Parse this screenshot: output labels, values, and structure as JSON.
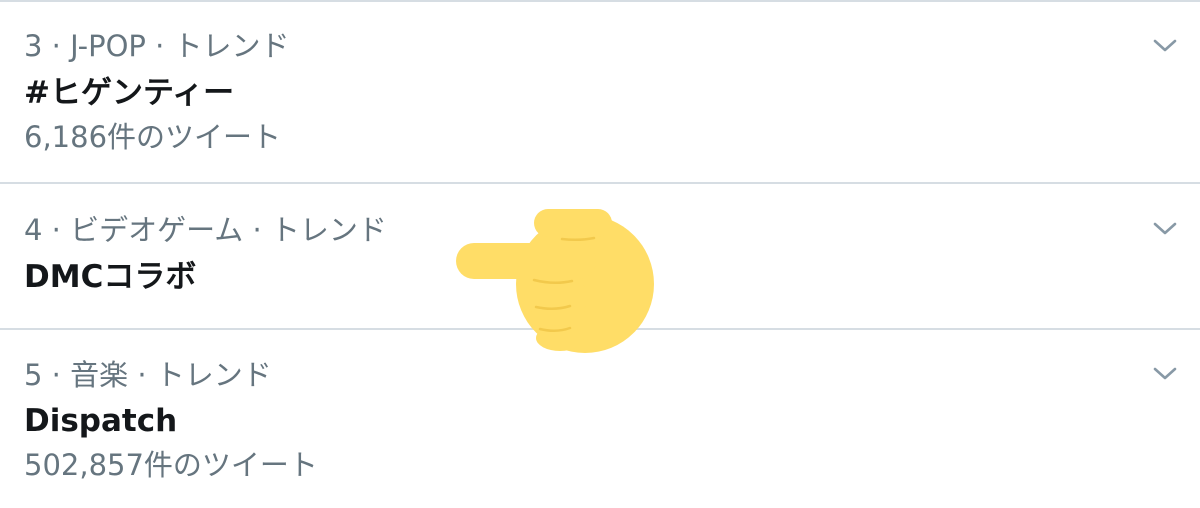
{
  "trends": [
    {
      "meta": "3 · J-POP · トレンド",
      "title": "#ヒゲンティー",
      "count": "6,186件のツイート"
    },
    {
      "meta": "4 · ビデオゲーム · トレンド",
      "title": "DMCコラボ"
    },
    {
      "meta": "5 · 音楽 · トレンド",
      "title": "Dispatch",
      "count": "502,857件のツイート"
    }
  ],
  "icons": {
    "more": "chevron-down-icon",
    "pointer": "pointing-hand-icon"
  },
  "colors": {
    "meta_text": "#66757f",
    "title_text": "#14171a",
    "divider": "#d6dde3",
    "hand": "#ffdd67"
  }
}
